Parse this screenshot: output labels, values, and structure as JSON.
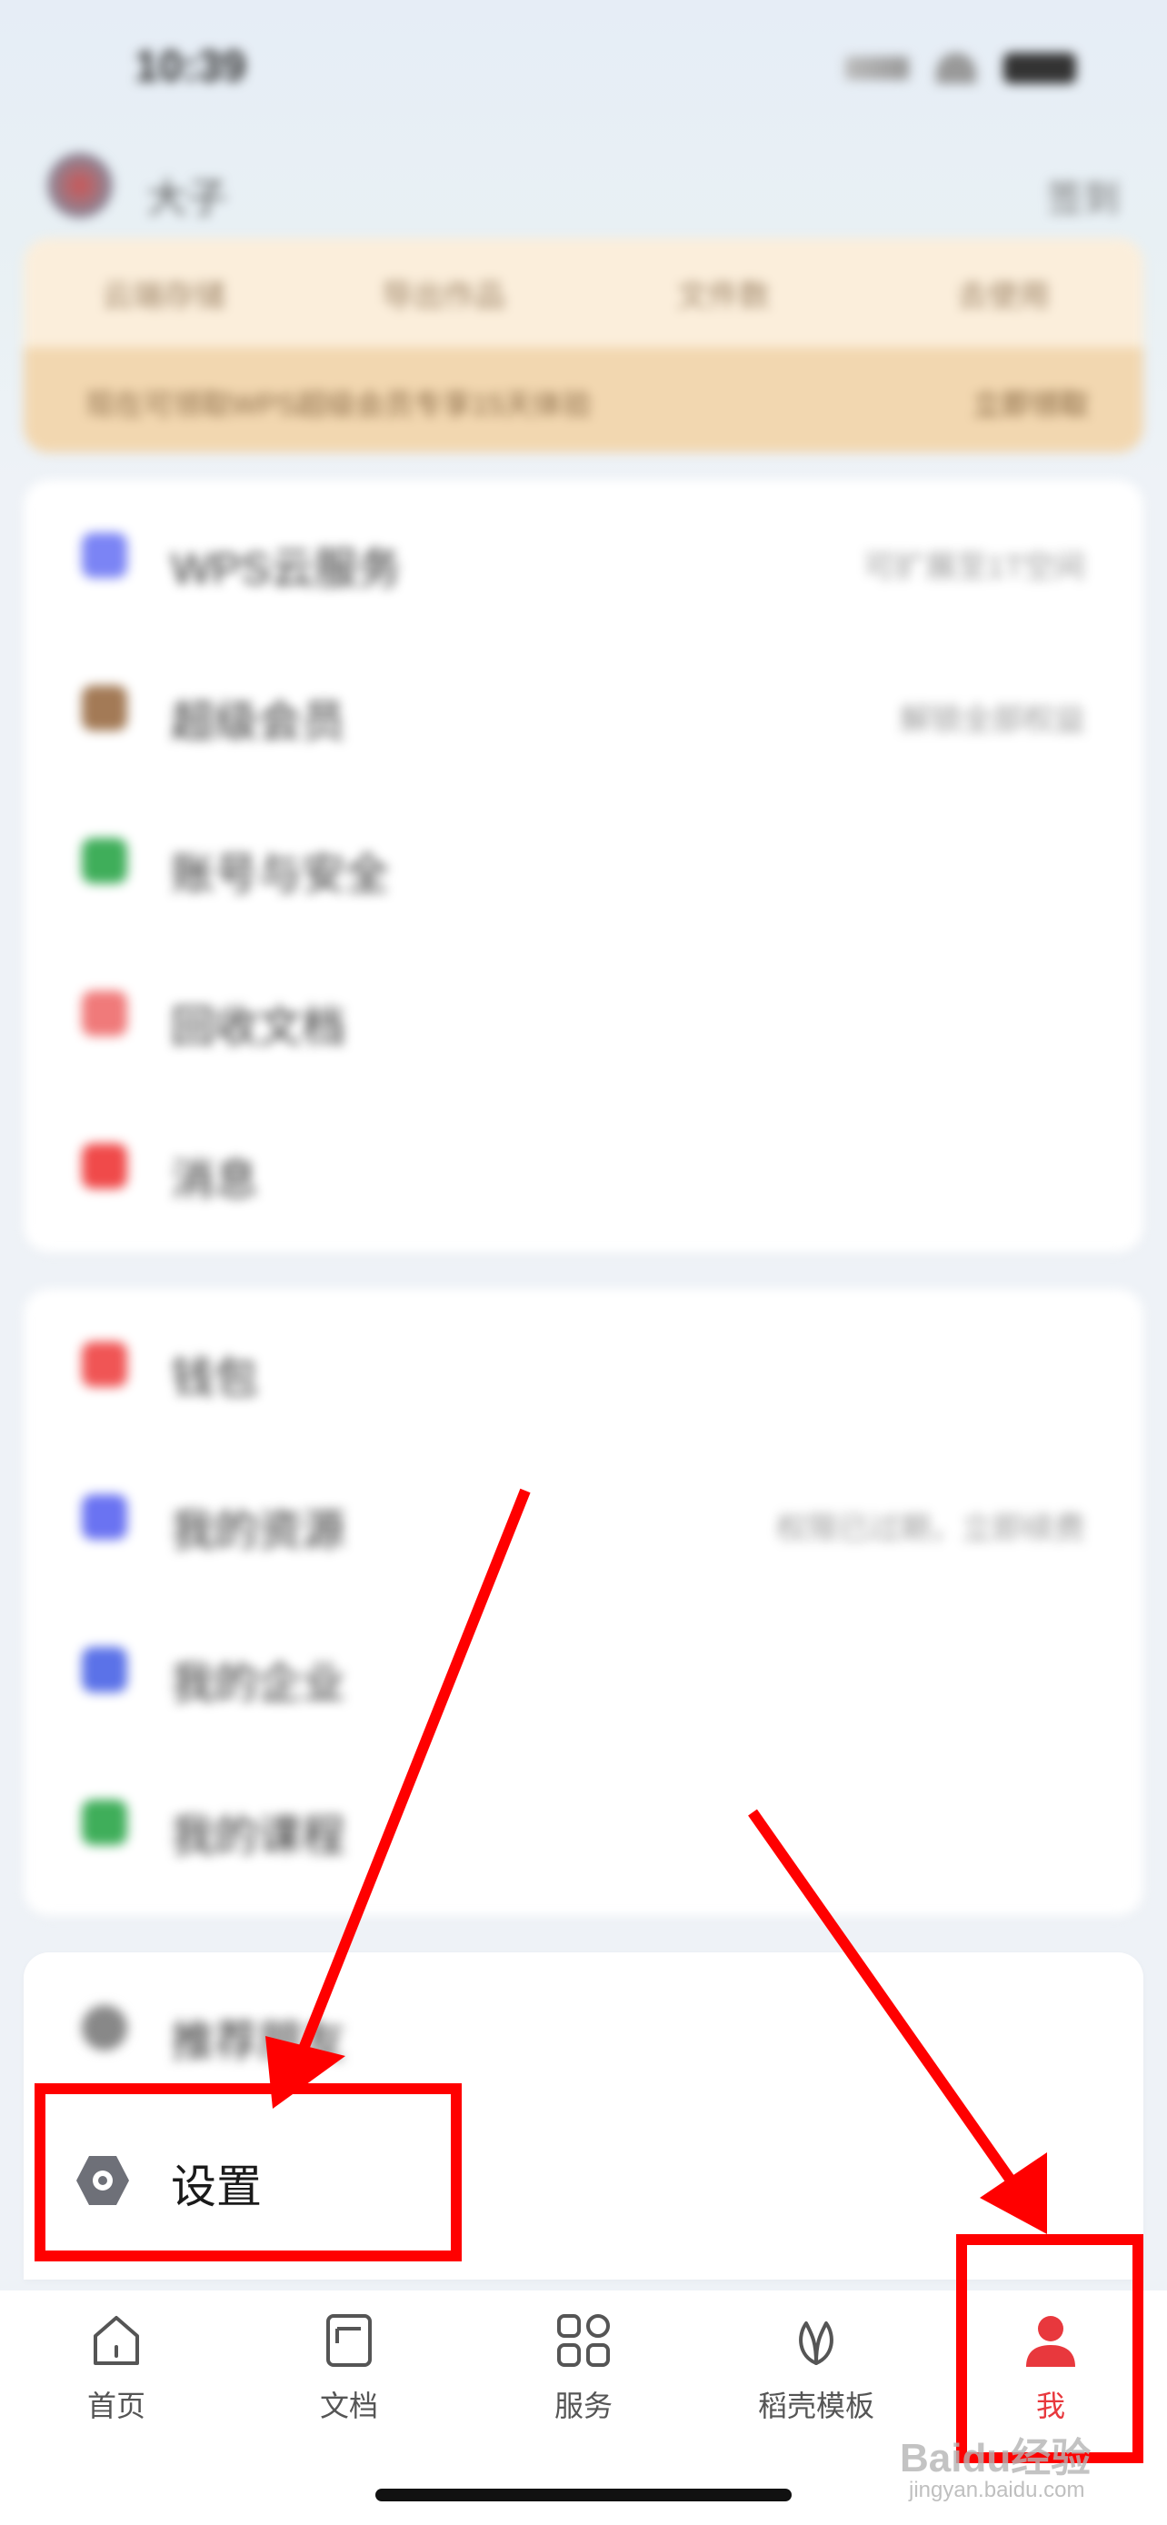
{
  "status_bar": {
    "time": "10:39"
  },
  "profile": {
    "username": "大子",
    "right_action": "签到"
  },
  "vip_card": {
    "stats": [
      {
        "label": "云端存储"
      },
      {
        "label": "导出作品"
      },
      {
        "label": "文件数"
      },
      {
        "label": "去使用"
      }
    ],
    "banner_text": "现在可领取WPS超级会员专享15天体验",
    "banner_action": "立即领取"
  },
  "card1": {
    "items": [
      {
        "label": "WPS云服务",
        "right": "可扩展至1T空间",
        "color": "#7b84f5"
      },
      {
        "label": "超级会员",
        "right": "解锁全部权益",
        "color": "#a37a56"
      },
      {
        "label": "账号与安全",
        "right": "",
        "color": "#3fae5a"
      },
      {
        "label": "回收文档",
        "right": "",
        "color": "#f07a7a"
      },
      {
        "label": "消息",
        "right": "",
        "color": "#f04a4a"
      }
    ]
  },
  "card2": {
    "items": [
      {
        "label": "钱包",
        "right": "",
        "color": "#f05555"
      },
      {
        "label": "我的资源",
        "right": "权限已过期，立即续费",
        "color": "#6a73f2"
      },
      {
        "label": "我的企业",
        "right": "",
        "color": "#5b72e8"
      },
      {
        "label": "我的课程",
        "right": "",
        "color": "#3fae5a"
      }
    ]
  },
  "card3": {
    "partial_label": "推荐朋友",
    "color": "#888888"
  },
  "settings": {
    "label": "设置"
  },
  "tabbar": {
    "tabs": [
      {
        "label": "首页",
        "icon": "home-icon"
      },
      {
        "label": "文档",
        "icon": "document-icon"
      },
      {
        "label": "服务",
        "icon": "grid-icon"
      },
      {
        "label": "稻壳模板",
        "icon": "leaf-icon"
      },
      {
        "label": "我",
        "icon": "person-icon"
      }
    ],
    "active": "我",
    "active_color": "#e8383d"
  },
  "watermark": {
    "text": "Baidu经验",
    "sub": "jingyan.baidu.com"
  },
  "annotation_color": "#ff0000"
}
